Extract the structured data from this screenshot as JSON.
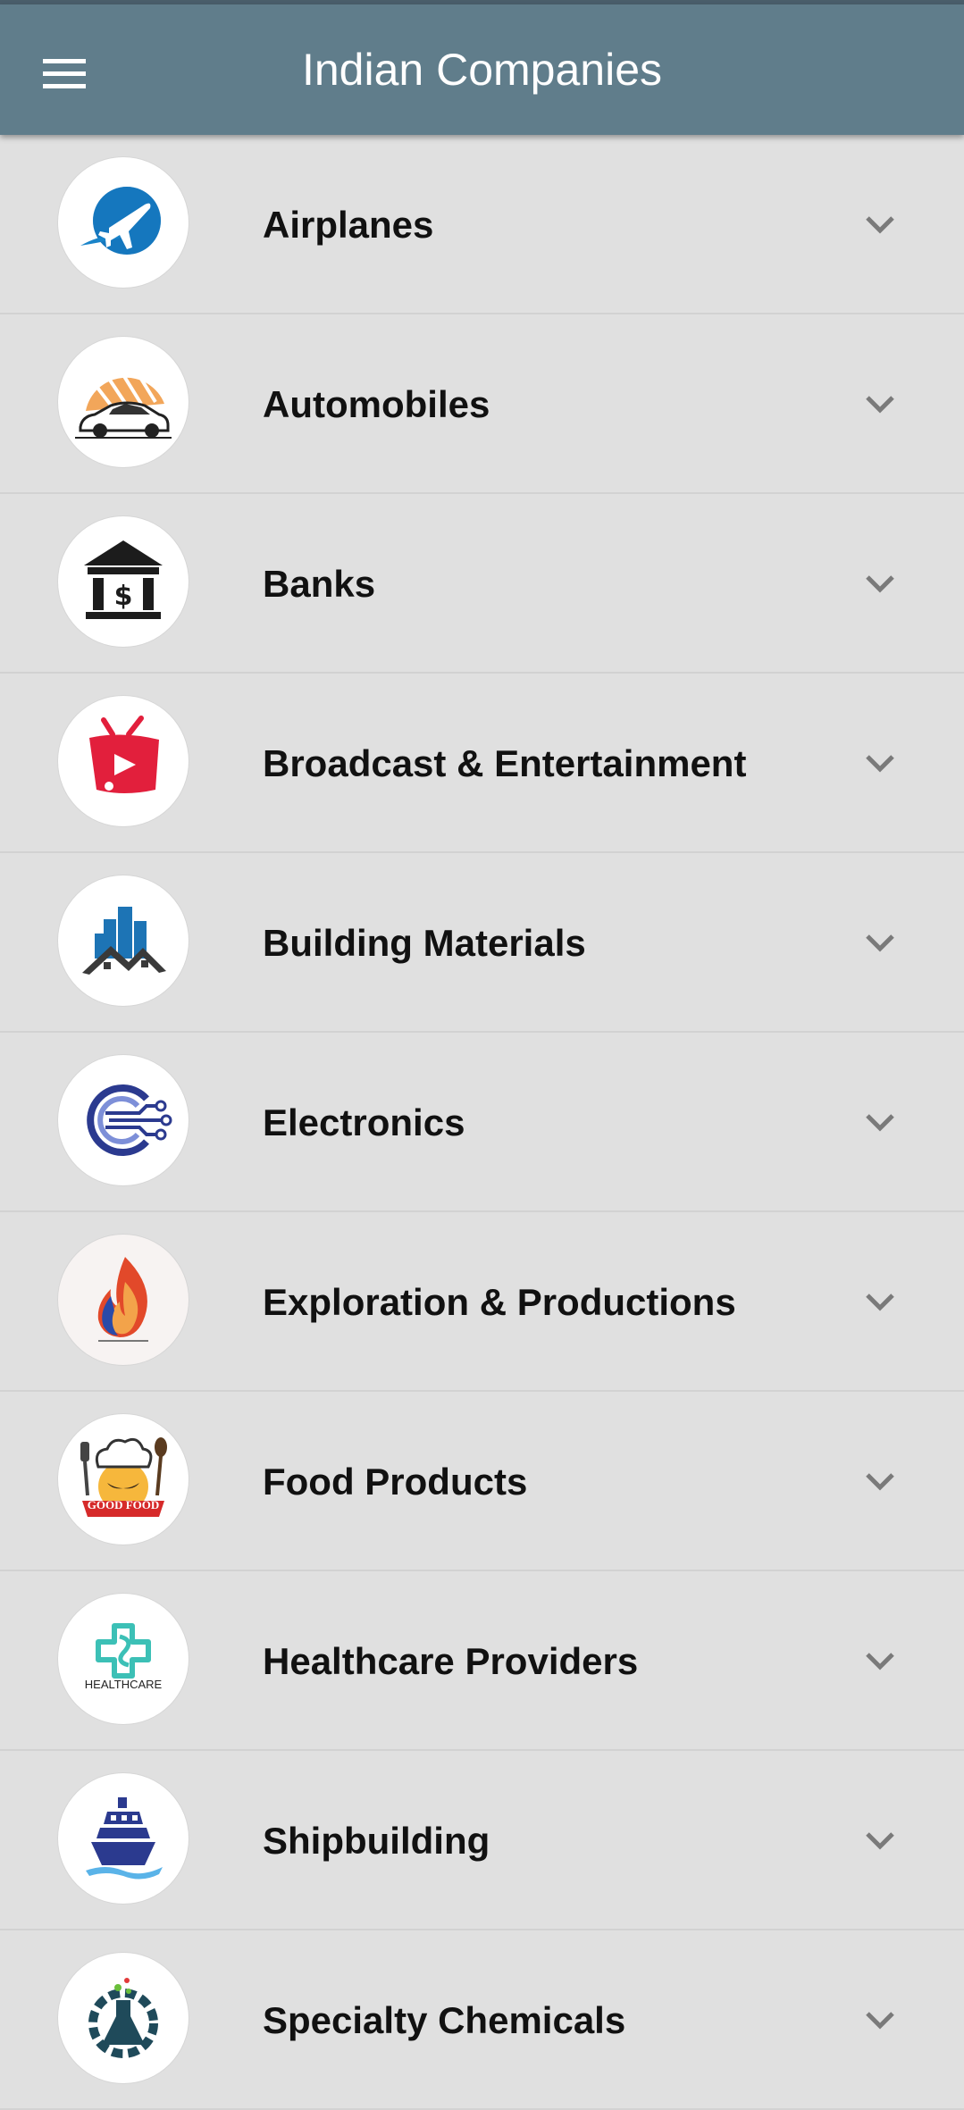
{
  "header": {
    "title": "Indian Companies",
    "menu_icon": "hamburger-menu-icon",
    "background": "#607d8b"
  },
  "categories": [
    {
      "label": "Airplanes",
      "icon": "airplane-icon"
    },
    {
      "label": "Automobiles",
      "icon": "car-icon"
    },
    {
      "label": "Banks",
      "icon": "bank-icon"
    },
    {
      "label": "Broadcast & Entertainment",
      "icon": "tv-icon"
    },
    {
      "label": "Building Materials",
      "icon": "buildings-icon"
    },
    {
      "label": "Electronics",
      "icon": "circuit-icon"
    },
    {
      "label": "Exploration & Productions",
      "icon": "flame-icon"
    },
    {
      "label": "Food Products",
      "icon": "chef-icon",
      "badge": "GOOD FOOD"
    },
    {
      "label": "Healthcare Providers",
      "icon": "healthcare-cross-icon",
      "badge": "HEALTHCARE"
    },
    {
      "label": "Shipbuilding",
      "icon": "ship-icon"
    },
    {
      "label": "Specialty Chemicals",
      "icon": "flask-gear-icon"
    }
  ],
  "expand_icon": "chevron-down-icon"
}
